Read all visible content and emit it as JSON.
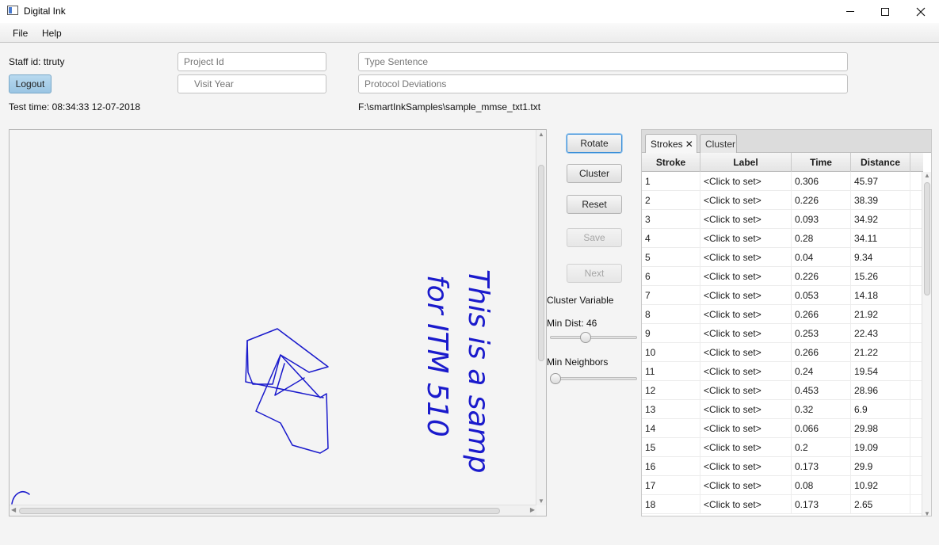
{
  "window": {
    "title": "Digital Ink"
  },
  "menu": {
    "file": "File",
    "help": "Help"
  },
  "form": {
    "staff_id": "Staff id: ttruty",
    "logout_label": "Logout",
    "test_time": "Test time: 08:34:33 12-07-2018",
    "project_id_placeholder": "Project Id",
    "visit_year_placeholder": "Visit Year",
    "type_sentence_placeholder": "Type Sentence",
    "protocol_deviations_placeholder": "Protocol Deviations",
    "file_path": "F:\\smartInkSamples\\sample_mmse_txt1.txt"
  },
  "controls": {
    "rotate": "Rotate",
    "cluster": "Cluster",
    "reset": "Reset",
    "save": "Save",
    "next": "Next",
    "cluster_variable": "Cluster  Variable",
    "min_dist_label": "Min Dist: 46",
    "min_dist_value": 0.4,
    "min_neighbors_label": "Min Neighbors",
    "min_neighbors_value": 0.0
  },
  "tabs": {
    "strokes": "Strokes",
    "cluster": "Cluster"
  },
  "table": {
    "columns": [
      "Stroke",
      "Label",
      "Time",
      "Distance"
    ],
    "rows": [
      [
        "1",
        "<Click to set>",
        "0.306",
        "45.97"
      ],
      [
        "2",
        "<Click to set>",
        "0.226",
        "38.39"
      ],
      [
        "3",
        "<Click to set>",
        "0.093",
        "34.92"
      ],
      [
        "4",
        "<Click to set>",
        "0.28",
        "34.11"
      ],
      [
        "5",
        "<Click to set>",
        "0.04",
        "9.34"
      ],
      [
        "6",
        "<Click to set>",
        "0.226",
        "15.26"
      ],
      [
        "7",
        "<Click to set>",
        "0.053",
        "14.18"
      ],
      [
        "8",
        "<Click to set>",
        "0.266",
        "21.92"
      ],
      [
        "9",
        "<Click to set>",
        "0.253",
        "22.43"
      ],
      [
        "10",
        "<Click to set>",
        "0.266",
        "21.22"
      ],
      [
        "11",
        "<Click to set>",
        "0.24",
        "19.54"
      ],
      [
        "12",
        "<Click to set>",
        "0.453",
        "28.96"
      ],
      [
        "13",
        "<Click to set>",
        "0.32",
        "6.9"
      ],
      [
        "14",
        "<Click to set>",
        "0.066",
        "29.98"
      ],
      [
        "15",
        "<Click to set>",
        "0.2",
        "19.09"
      ],
      [
        "16",
        "<Click to set>",
        "0.173",
        "29.9"
      ],
      [
        "17",
        "<Click to set>",
        "0.08",
        "10.92"
      ],
      [
        "18",
        "<Click to set>",
        "0.173",
        "2.65"
      ]
    ]
  },
  "canvas": {
    "ink_color": "#1a1acc",
    "handwriting_line1": "This is a samp",
    "handwriting_line2": "for ITM 510"
  }
}
